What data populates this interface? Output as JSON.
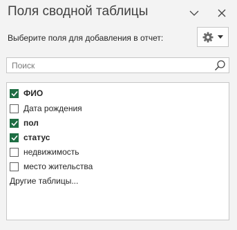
{
  "panel": {
    "title": "Поля сводной таблицы",
    "prompt": "Выберите поля для добавления в отчет:"
  },
  "header_buttons": [
    {
      "name": "chevron-down-icon",
      "icon": "chevron-down"
    },
    {
      "name": "close-icon",
      "icon": "close-x"
    }
  ],
  "tools_button": {
    "icon": "gear-icon",
    "dropdown_icon": "caret-down-icon"
  },
  "search": {
    "placeholder": "Поиск",
    "value": "",
    "icon": "search-icon"
  },
  "fields": [
    {
      "label": "ФИО",
      "checked": true,
      "bold": true
    },
    {
      "label": "Дата рождения",
      "checked": false,
      "bold": false
    },
    {
      "label": "пол",
      "checked": true,
      "bold": true
    },
    {
      "label": "статус",
      "checked": true,
      "bold": true
    },
    {
      "label": "недвижимость",
      "checked": false,
      "bold": false
    },
    {
      "label": "место жительства",
      "checked": false,
      "bold": false
    }
  ],
  "more_tables": "Другие таблицы...",
  "colors": {
    "accent_check": "#1e6e43",
    "background": "#f3f3f3",
    "border": "#c6c6c6"
  }
}
